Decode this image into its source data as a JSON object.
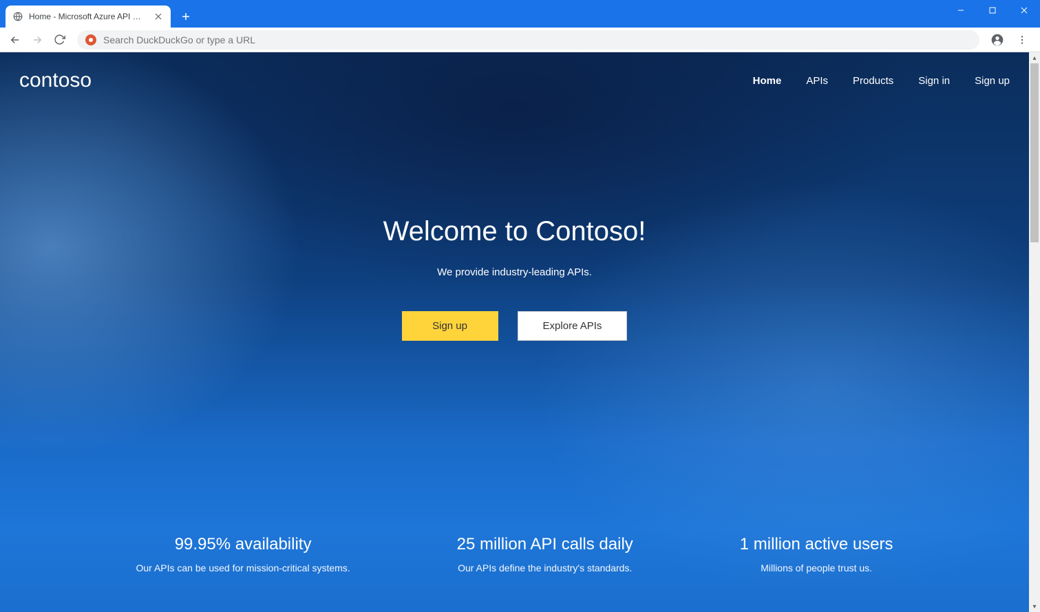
{
  "browser": {
    "tab_title": "Home - Microsoft Azure API Man",
    "omnibox_placeholder": "Search DuckDuckGo or type a URL"
  },
  "header": {
    "brand": "contoso",
    "nav": [
      {
        "label": "Home",
        "active": true
      },
      {
        "label": "APIs",
        "active": false
      },
      {
        "label": "Products",
        "active": false
      },
      {
        "label": "Sign in",
        "active": false
      },
      {
        "label": "Sign up",
        "active": false
      }
    ]
  },
  "hero": {
    "title": "Welcome to Contoso!",
    "tagline": "We provide industry-leading APIs.",
    "cta_primary": "Sign up",
    "cta_secondary": "Explore APIs"
  },
  "features": [
    {
      "title": "99.95% availability",
      "desc": "Our APIs can be used for mission-critical systems."
    },
    {
      "title": "25 million API calls daily",
      "desc": "Our APIs define the industry's standards."
    },
    {
      "title": "1 million active users",
      "desc": "Millions of people trust us."
    }
  ]
}
